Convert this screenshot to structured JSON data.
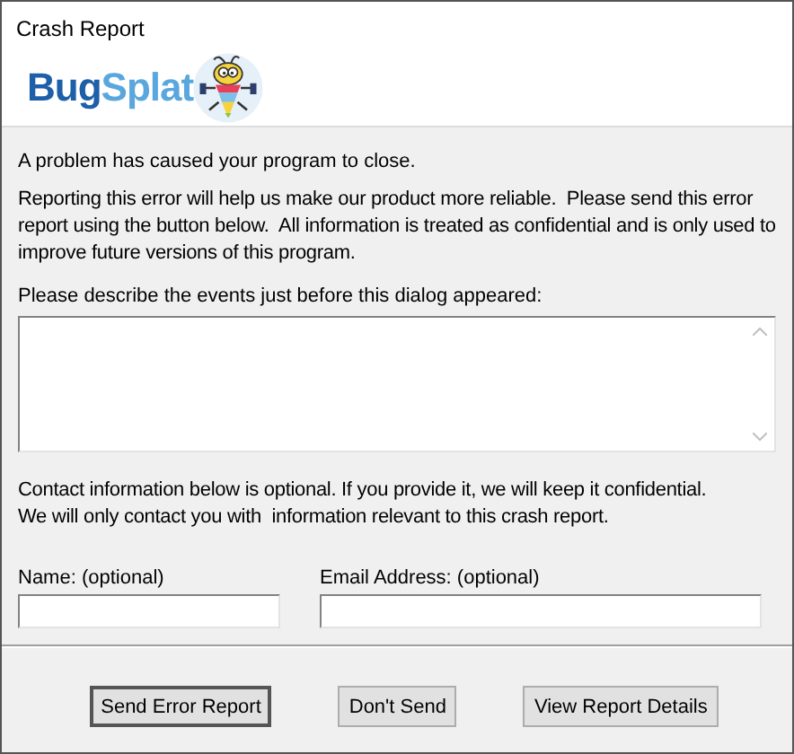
{
  "window": {
    "title": "Crash Report"
  },
  "logo": {
    "part_1": "Bug",
    "part_2": "Splat"
  },
  "intro": "A problem has caused your program to close.",
  "explanation": "Reporting this error will help us make our product more reliable.  Please send this error report using the button below.  All information is treated as confidential and is only used to improve future versions of this program.",
  "description": {
    "label": "Please describe the events just before this dialog appeared:"
  },
  "contact_note": [
    "Contact information below is optional. If you provide it, we will keep it confidential.",
    "We will only contact you with  information relevant to this crash report."
  ],
  "fields": [
    {
      "label": "Name: (optional)"
    },
    {
      "label": "Email Address: (optional)"
    }
  ],
  "buttons": [
    {
      "label": "Send Error Report",
      "default": true
    },
    {
      "label": "Don't Send",
      "default": false
    },
    {
      "label": "View Report Details",
      "default": false
    }
  ]
}
